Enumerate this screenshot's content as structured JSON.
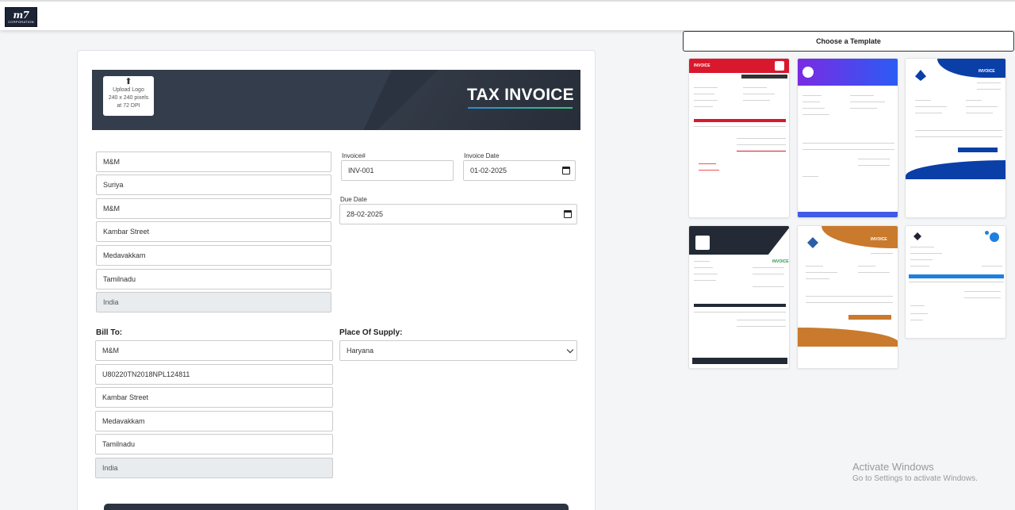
{
  "app": {
    "logo_text": "m7",
    "logo_subtext": "CORPORATION"
  },
  "invoice": {
    "title": "TAX INVOICE",
    "upload": {
      "label": "Upload Logo",
      "size": "240 x 240 pixels",
      "dpi": "at 72 DPI"
    },
    "from": {
      "company": "M&M",
      "name": "Suriya",
      "company2": "M&M",
      "street": "Kambar Street",
      "city": "Medavakkam",
      "state": "Tamilnadu",
      "country": "India"
    },
    "invoice_no_label": "Invoice#",
    "invoice_no": "INV-001",
    "invoice_date_label": "Invoice Date",
    "invoice_date": "01-02-2025",
    "due_date_label": "Due Date",
    "due_date": "28-02-2025",
    "bill_to_label": "Bill To:",
    "bill_to": {
      "company": "M&M",
      "gstin": "U80220TN2018NPL124811",
      "street": "Kambar Street",
      "city": "Medavakkam",
      "state": "Tamilnadu",
      "country": "India"
    },
    "place_of_supply_label": "Place Of Supply:",
    "place_of_supply": "Haryana"
  },
  "templates": {
    "header": "Choose a Template",
    "items": [
      {
        "name": "Red",
        "title": "INVOICE",
        "accent": "#d9182d"
      },
      {
        "name": "Purple",
        "title": "",
        "accent": "#5b3df5"
      },
      {
        "name": "Blue",
        "title": "INVOICE",
        "accent": "#0a3fa8"
      },
      {
        "name": "Dark",
        "title": "INVOICE",
        "accent": "#232a35"
      },
      {
        "name": "Orange",
        "title": "INVOICE",
        "accent": "#c97a2c"
      },
      {
        "name": "Minimal",
        "title": "",
        "accent": "#1f7fe0"
      }
    ]
  },
  "watermark": {
    "line1": "Activate Windows",
    "line2": "Go to Settings to activate Windows."
  },
  "icons": {
    "upload": "upload-arrow-icon",
    "calendar": "calendar-icon",
    "dropdown": "chevron-down-icon"
  }
}
